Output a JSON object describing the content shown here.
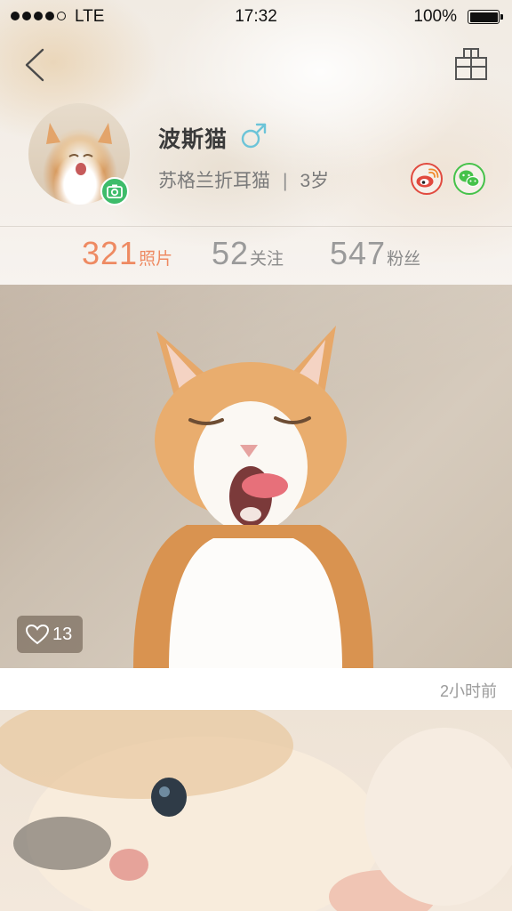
{
  "status_bar": {
    "carrier": "LTE",
    "time": "17:32",
    "battery_percent": "100%",
    "battery_level": 1.0,
    "signal_bars_filled": 4,
    "signal_bars_total": 5
  },
  "nav": {
    "back_icon": "chevron-left-icon",
    "shop_icon": "shopping-bag-icon"
  },
  "profile": {
    "name": "波斯猫",
    "gender": "male",
    "gender_symbol": "♂",
    "breed": "苏格兰折耳猫",
    "separator": "|",
    "age": "3岁",
    "share": [
      {
        "name": "weibo",
        "icon": "weibo-icon",
        "color": "#e14a3f"
      },
      {
        "name": "wechat",
        "icon": "wechat-icon",
        "color": "#45c24a"
      }
    ],
    "camera_badge_color": "#3ebc6a"
  },
  "stats": {
    "photos_count": "321",
    "photos_label": "照片",
    "following_count": "52",
    "following_label": "关注",
    "fans_count": "547",
    "fans_label": "粉丝"
  },
  "colors": {
    "accent": "#ee8a62",
    "gender_blue": "#6cc4d8",
    "muted_text": "#9a9a9a"
  },
  "posts": [
    {
      "likes": "13",
      "like_icon": "heart-outline-icon",
      "time": "2小时前"
    }
  ]
}
